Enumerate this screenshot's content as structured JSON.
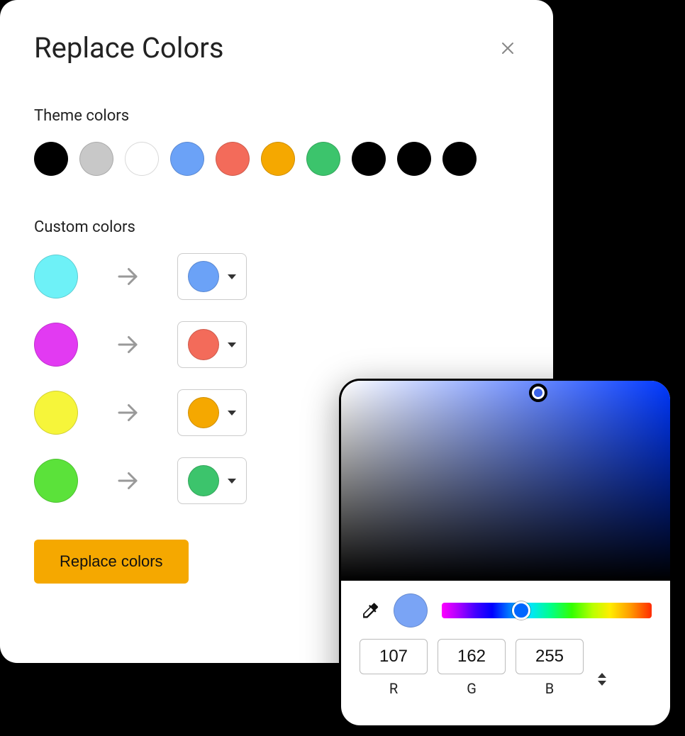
{
  "dialog": {
    "title": "Replace Colors",
    "closeIcon": "close-icon"
  },
  "theme": {
    "label": "Theme colors",
    "colors": [
      "#000000",
      "#c8c8c8",
      "#ffffff",
      "#6ba2f7",
      "#f36b5a",
      "#f5a800",
      "#3cc46c",
      "#000000",
      "#000000",
      "#000000"
    ]
  },
  "custom": {
    "label": "Custom colors",
    "rows": [
      {
        "from": "#6ef1f7",
        "to": "#6ba2f7"
      },
      {
        "from": "#e23af2",
        "to": "#f36b5a"
      },
      {
        "from": "#f6f53a",
        "to": "#f5a800"
      },
      {
        "from": "#5be23a",
        "to": "#3cc46c"
      }
    ]
  },
  "button": {
    "label": "Replace colors"
  },
  "picker": {
    "preview": "#7aa4f5",
    "rgb": {
      "r": "107",
      "g": "162",
      "b": "255"
    },
    "labels": {
      "r": "R",
      "g": "G",
      "b": "B"
    }
  }
}
